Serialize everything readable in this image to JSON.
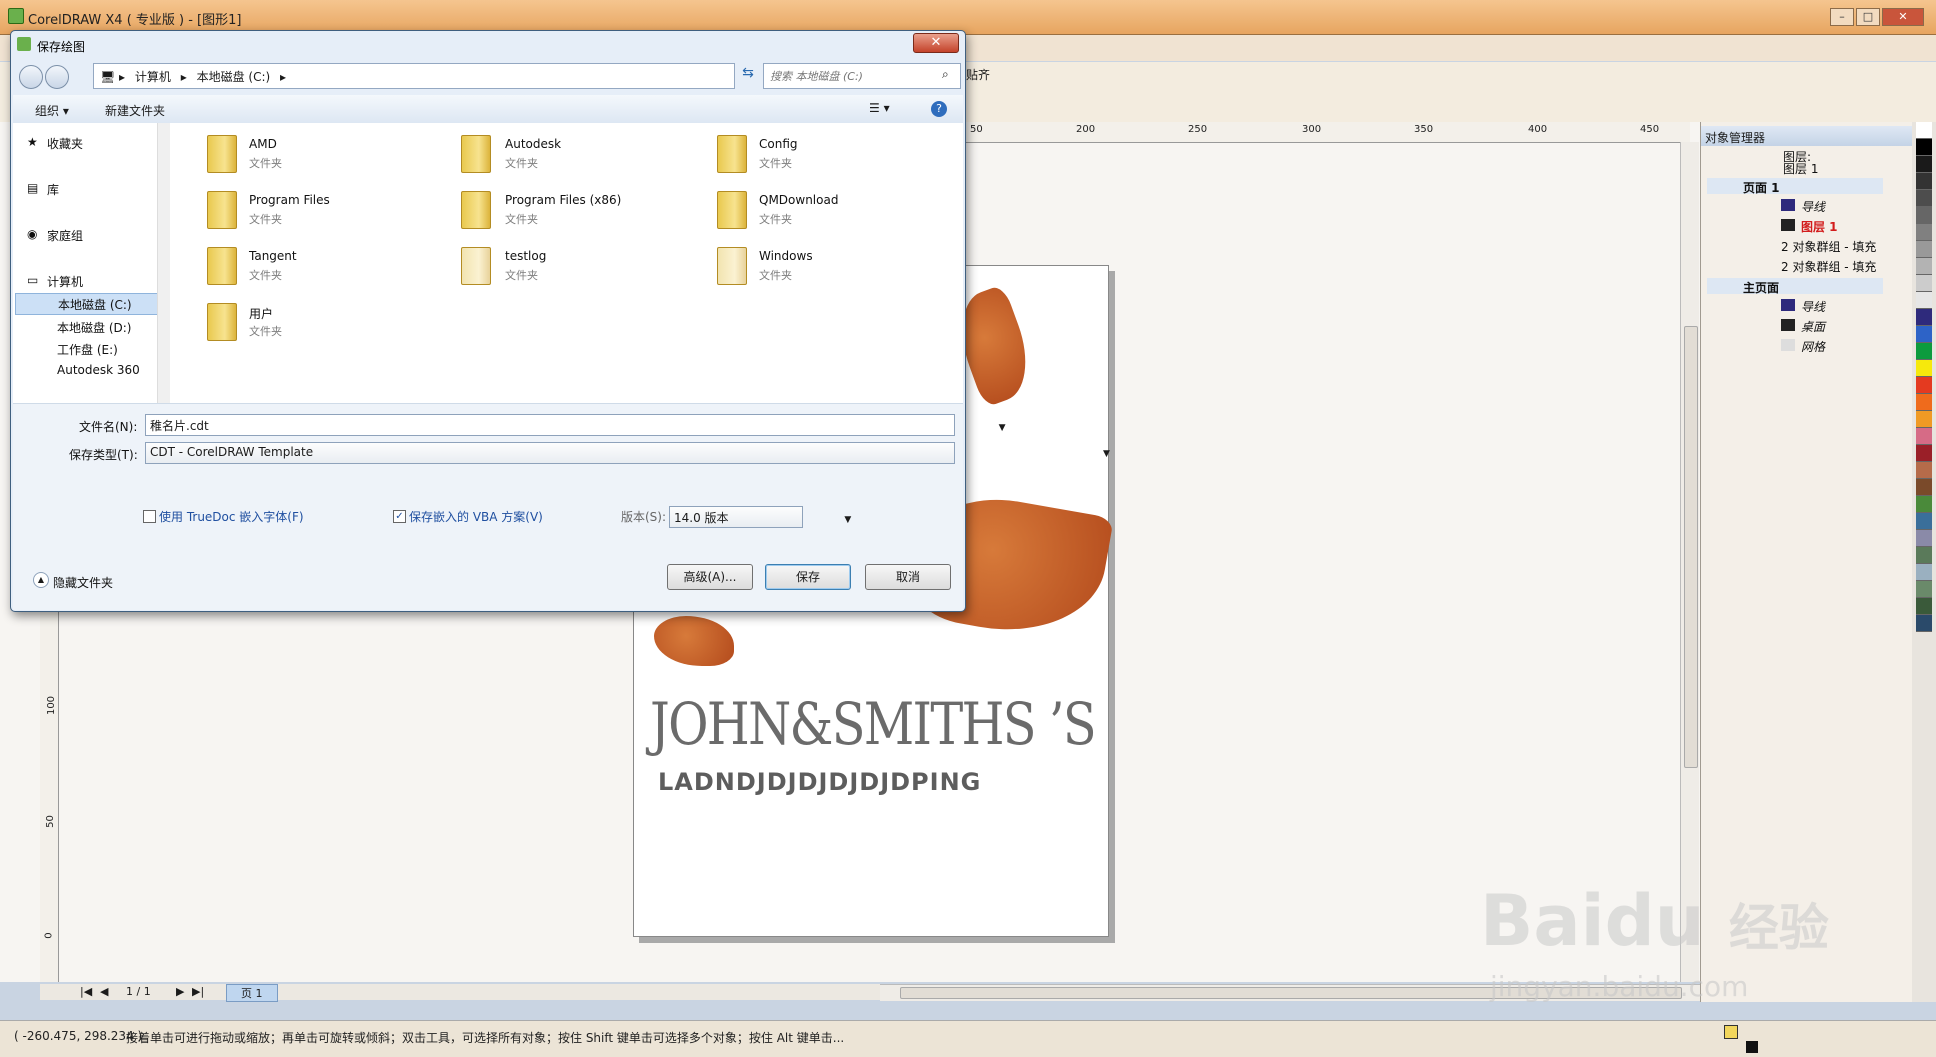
{
  "window": {
    "title": "CorelDRAW X4 ( 专业版 ) - [图形1]"
  },
  "toolbar": {
    "snap_label": "贴齐"
  },
  "ruler": {
    "h_ticks": [
      "50",
      "200",
      "250",
      "300",
      "350",
      "400",
      "450"
    ],
    "v_ticks": [
      "100",
      "50",
      "0"
    ]
  },
  "document": {
    "brand": "JOHN&SMITHS ’S",
    "subtitle": "LADNDJDJDJDJDJDPING"
  },
  "page_nav": {
    "counter": "1 / 1",
    "tab": "页 1"
  },
  "status": {
    "coords": "( -260.475, 298.234 )",
    "hint": "接着单击可进行拖动或缩放；再单击可旋转或倾斜；双击工具，可选择所有对象；按住 Shift 键单击可选择多个对象；按住 Alt 键单击..."
  },
  "docker": {
    "title": "对象管理器",
    "header_labels": [
      "图层:",
      "图层 1"
    ],
    "page1": "页面 1",
    "page1_items": [
      "导线",
      "图层 1",
      "2 对象群组 - 填充",
      "2 对象群组 - 填充"
    ],
    "master": "主页面",
    "master_items": [
      "导线",
      "桌面",
      "网格"
    ]
  },
  "dialog": {
    "title": "保存绘图",
    "close": "✕",
    "breadcrumb": [
      "计算机",
      "本地磁盘 (C:)"
    ],
    "search_placeholder": "搜索 本地磁盘 (C:)",
    "organize": "组织 ▾",
    "new_folder": "新建文件夹",
    "nav": [
      "收藏夹",
      "库",
      "家庭组",
      "计算机",
      "本地磁盘 (C:)",
      "本地磁盘 (D:)",
      "工作盘 (E:)",
      "Autodesk 360"
    ],
    "folders": [
      {
        "name": "AMD",
        "type": "文件夹"
      },
      {
        "name": "Autodesk",
        "type": "文件夹"
      },
      {
        "name": "Config",
        "type": "文件夹"
      },
      {
        "name": "Program Files",
        "type": "文件夹"
      },
      {
        "name": "Program Files (x86)",
        "type": "文件夹"
      },
      {
        "name": "QMDownload",
        "type": "文件夹"
      },
      {
        "name": "Tangent",
        "type": "文件夹"
      },
      {
        "name": "testlog",
        "type": "文件夹"
      },
      {
        "name": "Windows",
        "type": "文件夹"
      },
      {
        "name": "用户",
        "type": "文件夹"
      }
    ],
    "filename_label": "文件名(N):",
    "filename_value": "稚名片.cdt",
    "type_label": "保存类型(T):",
    "type_value": "CDT - CorelDRAW Template",
    "truedoc": "使用 TrueDoc 嵌入字体(F)",
    "vba": "保存嵌入的 VBA 方案(V)",
    "version_label": "版本(S):",
    "version_value": "14.0 版本",
    "hide_folders": "隐藏文件夹",
    "advanced": "高级(A)...",
    "save": "保存",
    "cancel": "取消"
  },
  "watermark": {
    "text1": "Bai",
    "text2": "du",
    "text3": "经验",
    "text4": "jingyan.baidu.com"
  },
  "palette_colors": [
    "#ffffff",
    "#000000",
    "#1a1a1a",
    "#333333",
    "#4d4d4d",
    "#666666",
    "#808080",
    "#999999",
    "#b3b3b3",
    "#cccccc",
    "#e6e6e6",
    "#2e2a7c",
    "#2d63c7",
    "#0c9b3e",
    "#f6e90c",
    "#e43a20",
    "#ef6b1c",
    "#f09a24",
    "#d66b86",
    "#9a1f28",
    "#b56b4a",
    "#7a4a2a",
    "#4a8a3a",
    "#3a6f9a",
    "#8a8aa8",
    "#5a7a5a",
    "#9ab0c0",
    "#6a8a6a",
    "#3a5a3a",
    "#2a4a6a"
  ]
}
